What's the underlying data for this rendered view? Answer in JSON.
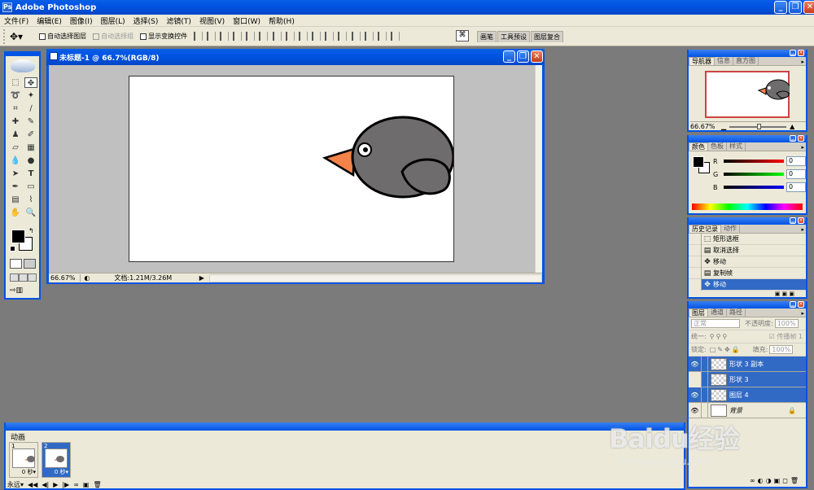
{
  "app": {
    "title": "Adobe Photoshop",
    "window_buttons": [
      "_",
      "❐",
      "✕"
    ]
  },
  "menu": [
    "文件(F)",
    "编辑(E)",
    "图像(I)",
    "图层(L)",
    "选择(S)",
    "滤镜(T)",
    "视图(V)",
    "窗口(W)",
    "帮助(H)"
  ],
  "options": {
    "tool_icon": "move-tool",
    "auto_select_layer": "自动选择图层",
    "auto_select_group": "自动选择组",
    "show_transform": "显示变换控件",
    "palette_tabs": [
      "画笔",
      "工具预设",
      "图层复合"
    ]
  },
  "document": {
    "title": "未标题-1 @ 66.7%(RGB/8)",
    "zoom": "66.67%",
    "doc_info": "文档:1.21M/3.26M"
  },
  "colors": {
    "accent": "#0054e3",
    "bird_body": "#6f6c6e",
    "beak": "#f3834a",
    "foreground": "#000000",
    "background": "#ffffff"
  },
  "navigator": {
    "tabs": [
      "导航器",
      "信息",
      "直方图"
    ],
    "zoom": "66.67%"
  },
  "color_panel": {
    "tabs": [
      "颜色",
      "色板",
      "样式"
    ],
    "channels": [
      {
        "label": "R",
        "value": "0"
      },
      {
        "label": "G",
        "value": "0"
      },
      {
        "label": "B",
        "value": "0"
      }
    ]
  },
  "history": {
    "tabs": [
      "历史记录",
      "动作"
    ],
    "items": [
      {
        "label": "矩形选框",
        "selected": false
      },
      {
        "label": "取消选择",
        "selected": false
      },
      {
        "label": "移动",
        "selected": false
      },
      {
        "label": "复制帧",
        "selected": false
      },
      {
        "label": "移动",
        "selected": true
      }
    ]
  },
  "layers": {
    "tabs": [
      "图层",
      "通道",
      "路径"
    ],
    "blend_mode": "正常",
    "opacity_label": "不透明度:",
    "opacity": "100%",
    "unify_label": "统一:",
    "propagate_label": "传播帧 1",
    "lock_label": "锁定:",
    "fill_label": "填充:",
    "fill": "100%",
    "items": [
      {
        "name": "形状 3 副本",
        "visible": true,
        "selected": true
      },
      {
        "name": "形状 3",
        "visible": false,
        "selected": true
      },
      {
        "name": "图层 4",
        "visible": true,
        "selected": true
      },
      {
        "name": "背景",
        "visible": true,
        "selected": false,
        "locked": true
      }
    ]
  },
  "animation": {
    "title": "动画",
    "frames": [
      {
        "number": "1",
        "delay": "0 秒▾",
        "selected": false
      },
      {
        "number": "2",
        "delay": "0 秒▾",
        "selected": true
      }
    ],
    "loop": "永远▾"
  },
  "watermark": {
    "brand": "Baidu经验",
    "url": "jingyan.baidu.com"
  }
}
